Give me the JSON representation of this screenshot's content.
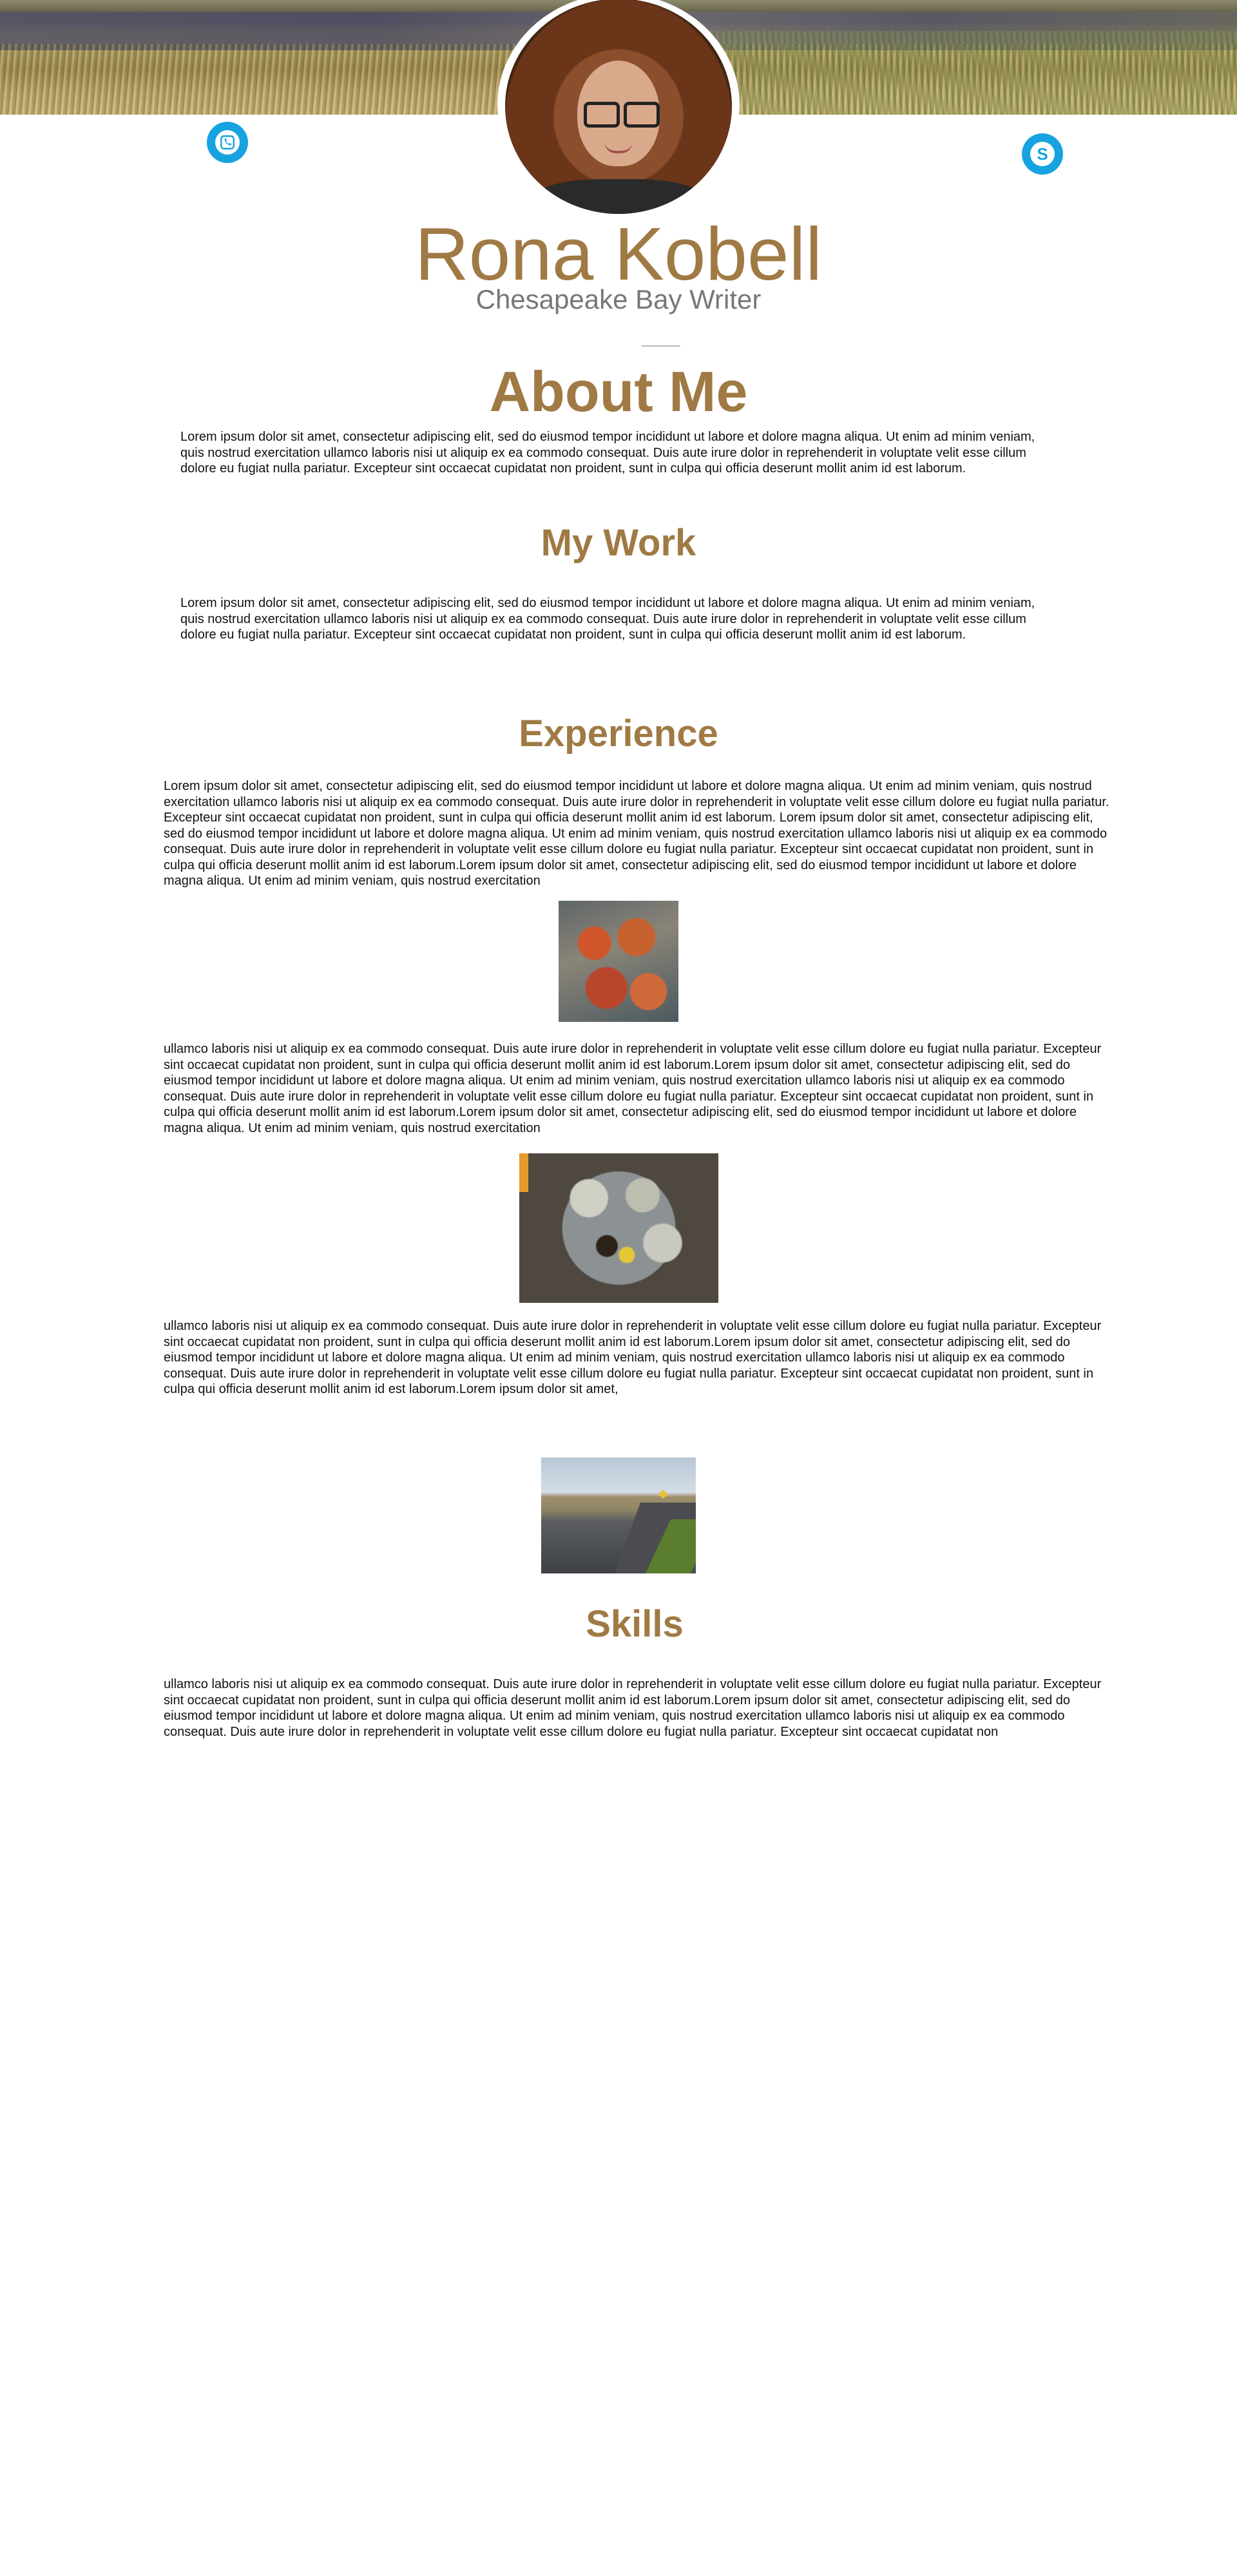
{
  "header": {
    "name": "Rona Kobell",
    "tagline": "Chesapeake Bay Writer"
  },
  "contact": {
    "phone_icon": "phone-icon",
    "skype_icon": "skype-icon",
    "brand_color": "#16a3e0"
  },
  "theme": {
    "heading_color": "#a07a44"
  },
  "sections": {
    "about": {
      "title": "About Me",
      "text": "Lorem ipsum dolor sit amet, consectetur adipiscing elit, sed do eiusmod tempor incididunt ut labore et dolore magna aliqua. Ut enim ad minim veniam, quis nostrud exercitation ullamco laboris nisi ut aliquip ex ea commodo consequat. Duis aute irure dolor in reprehenderit in voluptate velit esse cillum dolore eu fugiat nulla pariatur. Excepteur sint occaecat cupidatat non proident, sunt in culpa qui officia deserunt mollit anim id est laborum."
    },
    "work": {
      "title": "My Work",
      "text": "Lorem ipsum dolor sit amet, consectetur adipiscing elit, sed do eiusmod tempor incididunt ut labore et dolore magna aliqua. Ut enim ad minim veniam, quis nostrud exercitation ullamco laboris nisi ut aliquip ex ea commodo consequat. Duis aute irure dolor in reprehenderit in voluptate velit esse cillum dolore eu fugiat nulla pariatur. Excepteur sint occaecat cupidatat non proident, sunt in culpa qui officia deserunt mollit anim id est laborum."
    },
    "experience": {
      "title": "Experience",
      "text1": "Lorem ipsum dolor sit amet, consectetur adipiscing elit, sed do eiusmod tempor incididunt ut labore et dolore magna aliqua. Ut enim ad minim veniam, quis nostrud exercitation ullamco laboris nisi ut aliquip ex ea commodo consequat. Duis aute irure dolor in reprehenderit in voluptate velit esse cillum dolore eu fugiat nulla pariatur. Excepteur sint occaecat cupidatat non proident, sunt in culpa qui officia deserunt mollit anim id est laborum. Lorem ipsum dolor sit amet, consectetur adipiscing elit, sed do eiusmod tempor incididunt ut labore et dolore magna aliqua. Ut enim ad minim veniam, quis nostrud exercitation ullamco laboris nisi ut aliquip ex ea commodo consequat. Duis aute irure dolor in reprehenderit in voluptate velit esse cillum dolore eu fugiat nulla pariatur. Excepteur sint occaecat cupidatat non proident, sunt in culpa qui officia deserunt mollit anim id est laborum.Lorem ipsum dolor sit amet, consectetur adipiscing elit, sed do eiusmod tempor incididunt ut labore et dolore magna aliqua. Ut enim ad minim veniam, quis nostrud exercitation",
      "text2": "ullamco laboris nisi ut aliquip ex ea commodo consequat. Duis aute irure dolor in reprehenderit in voluptate velit esse cillum dolore eu fugiat nulla pariatur. Excepteur sint occaecat cupidatat non proident, sunt in culpa qui officia deserunt mollit anim id est laborum.Lorem ipsum dolor sit amet, consectetur adipiscing elit, sed do eiusmod tempor incididunt ut labore et dolore magna aliqua. Ut enim ad minim veniam, quis nostrud exercitation ullamco laboris nisi ut aliquip ex ea commodo consequat. Duis aute irure dolor in reprehenderit in voluptate velit esse cillum dolore eu fugiat nulla pariatur. Excepteur sint occaecat cupidatat non proident, sunt in culpa qui officia deserunt mollit anim id est laborum.Lorem ipsum dolor sit amet, consectetur adipiscing elit, sed do eiusmod tempor incididunt ut labore et dolore magna aliqua. Ut enim ad minim veniam, quis nostrud exercitation",
      "text3": " ullamco laboris nisi ut aliquip ex ea commodo consequat. Duis aute irure dolor in reprehenderit in voluptate velit esse cillum dolore eu fugiat nulla pariatur. Excepteur sint occaecat cupidatat non proident, sunt in culpa qui officia deserunt mollit anim id est laborum.Lorem ipsum dolor sit amet, consectetur adipiscing elit, sed do eiusmod tempor incididunt ut labore et dolore magna aliqua. Ut enim ad minim veniam, quis nostrud exercitation ullamco laboris nisi ut aliquip ex ea commodo consequat. Duis aute irure dolor in reprehenderit in voluptate velit esse cillum dolore eu fugiat nulla pariatur. Excepteur sint occaecat cupidatat non proident, sunt in culpa qui officia deserunt mollit anim id est laborum.Lorem ipsum dolor sit amet,"
    },
    "skills": {
      "title": "Skills",
      "text": " ullamco laboris nisi ut aliquip ex ea commodo consequat. Duis aute irure dolor in reprehenderit in voluptate velit esse cillum dolore eu fugiat nulla pariatur. Excepteur sint occaecat cupidatat non proident, sunt in culpa qui officia deserunt mollit anim id est laborum.Lorem ipsum dolor sit amet, consectetur adipiscing elit, sed do eiusmod tempor incididunt ut labore et dolore magna aliqua. Ut enim ad minim veniam, quis nostrud exercitation ullamco laboris nisi ut aliquip ex ea commodo consequat. Duis aute irure dolor in reprehenderit in voluptate velit esse cillum dolore eu fugiat nulla pariatur. Excepteur sint occaecat cupidatat non"
    }
  }
}
